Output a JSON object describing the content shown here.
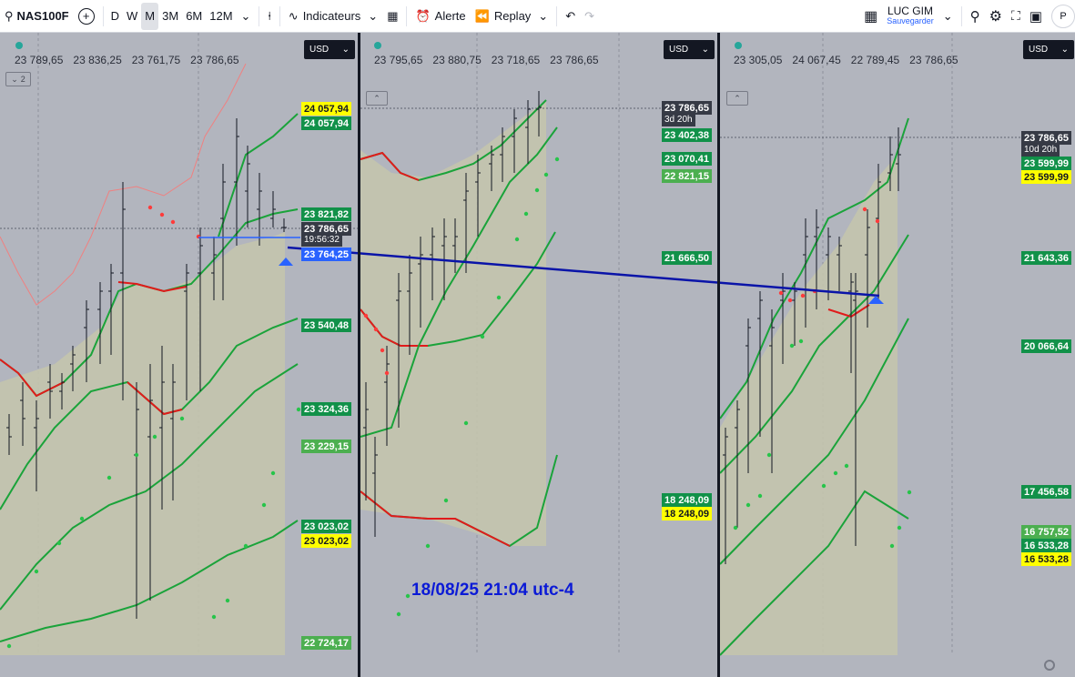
{
  "toolbar": {
    "symbol": "NAS100F",
    "add_symbol": "+",
    "timeframes": [
      "D",
      "W",
      "M",
      "3M",
      "6M",
      "12M"
    ],
    "active_timeframe": "M",
    "indicators_label": "Indicateurs",
    "alert_label": "Alerte",
    "replay_label": "Replay",
    "layout_name": "LUC GIM",
    "layout_status": "Sauvegarder",
    "avatar_letter": "P"
  },
  "panels": [
    {
      "ohlc": [
        "23 789,65",
        "23 836,25",
        "23 761,75",
        "23 786,65"
      ],
      "currency": "USD",
      "collapse_label": "2",
      "price_tags": [
        {
          "text": "24 057,94",
          "style": "y"
        },
        {
          "text": "24 057,94",
          "style": "g"
        },
        {
          "text": "23 821,82",
          "style": "g"
        },
        {
          "text": "23 786,65",
          "style": "dk"
        },
        {
          "text": "19:56:32",
          "style": "cd"
        },
        {
          "text": "23 764,25",
          "style": "b"
        },
        {
          "text": "23 540,48",
          "style": "g"
        },
        {
          "text": "23 324,36",
          "style": "g"
        },
        {
          "text": "23 229,15",
          "style": "lg"
        },
        {
          "text": "23 023,02",
          "style": "g"
        },
        {
          "text": "23 023,02",
          "style": "y"
        },
        {
          "text": "22 724,17",
          "style": "lg"
        }
      ]
    },
    {
      "ohlc": [
        "23 795,65",
        "23 880,75",
        "23 718,65",
        "23 786,65"
      ],
      "currency": "USD",
      "price_tags": [
        {
          "text": "23 786,65",
          "style": "dk"
        },
        {
          "text": "3d 20h",
          "style": "cd"
        },
        {
          "text": "23 402,38",
          "style": "g"
        },
        {
          "text": "23 070,41",
          "style": "g"
        },
        {
          "text": "22 821,15",
          "style": "lg"
        },
        {
          "text": "21 666,50",
          "style": "g"
        },
        {
          "text": "18 248,09",
          "style": "g"
        },
        {
          "text": "18 248,09",
          "style": "y"
        }
      ]
    },
    {
      "ohlc": [
        "23 305,05",
        "24 067,45",
        "22 789,45",
        "23 786,65"
      ],
      "currency": "USD",
      "price_tags": [
        {
          "text": "23 786,65",
          "style": "dk"
        },
        {
          "text": "10d 20h",
          "style": "cd"
        },
        {
          "text": "23 599,99",
          "style": "g"
        },
        {
          "text": "23 599,99",
          "style": "y"
        },
        {
          "text": "21 643,36",
          "style": "g"
        },
        {
          "text": "20 066,64",
          "style": "g"
        },
        {
          "text": "17 456,58",
          "style": "g"
        },
        {
          "text": "16 757,52",
          "style": "lg"
        },
        {
          "text": "16 533,28",
          "style": "g"
        },
        {
          "text": "16 533,28",
          "style": "y"
        }
      ]
    }
  ],
  "annotation": "18/08/25 21:04 utc-4",
  "colors": {
    "band_green": "#1aa33a",
    "band_red": "#e01b1b",
    "trend_line": "#0a14a8",
    "fill": "#c3c4ad"
  }
}
